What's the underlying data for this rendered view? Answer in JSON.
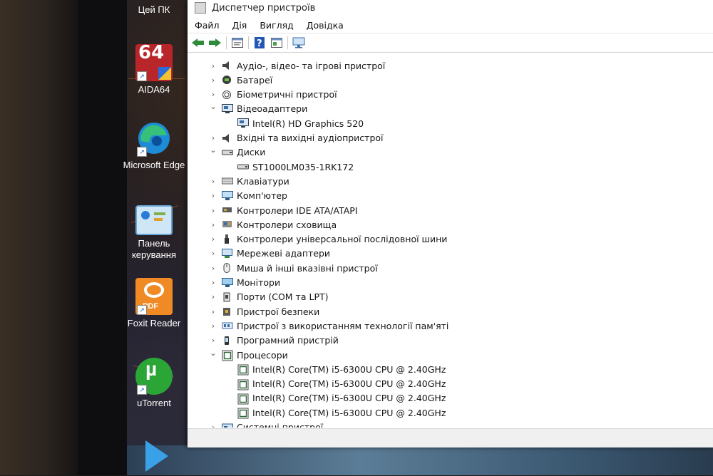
{
  "desktop": {
    "icons": [
      {
        "label": "Цей ПК"
      },
      {
        "label": "AIDA64",
        "badge": "64"
      },
      {
        "label": "Microsoft Edge"
      },
      {
        "label": "Панель керування"
      },
      {
        "label": "Foxit Reader",
        "badge": "PDF"
      },
      {
        "label": "uTorrent"
      }
    ]
  },
  "window": {
    "title": "Диспетчер пристроїв",
    "menu": [
      "Файл",
      "Дія",
      "Вигляд",
      "Довідка"
    ]
  },
  "tree": [
    {
      "label": "Аудіо-, відео- та ігрові пристрої",
      "level": 0,
      "state": "collapsed",
      "icon": "speaker-icon"
    },
    {
      "label": "Батареї",
      "level": 0,
      "state": "collapsed",
      "icon": "battery-icon"
    },
    {
      "label": "Біометричні пристрої",
      "level": 0,
      "state": "collapsed",
      "icon": "fingerprint-icon"
    },
    {
      "label": "Відеоадаптери",
      "level": 0,
      "state": "expanded",
      "icon": "display-adapter-icon"
    },
    {
      "label": "Intel(R) HD Graphics 520",
      "level": 1,
      "state": "leaf",
      "icon": "display-adapter-icon"
    },
    {
      "label": "Вхідні та вихідні аудіопристрої",
      "level": 0,
      "state": "collapsed",
      "icon": "speaker-icon"
    },
    {
      "label": "Диски",
      "level": 0,
      "state": "expanded",
      "icon": "disk-icon"
    },
    {
      "label": "ST1000LM035-1RK172",
      "level": 1,
      "state": "leaf",
      "icon": "disk-icon"
    },
    {
      "label": "Клавіатури",
      "level": 0,
      "state": "collapsed",
      "icon": "keyboard-icon"
    },
    {
      "label": "Комп'ютер",
      "level": 0,
      "state": "collapsed",
      "icon": "computer-icon"
    },
    {
      "label": "Контролери IDE ATA/ATAPI",
      "level": 0,
      "state": "collapsed",
      "icon": "controller-icon"
    },
    {
      "label": "Контролери сховища",
      "level": 0,
      "state": "collapsed",
      "icon": "storage-controller-icon"
    },
    {
      "label": "Контролери універсальної послідовної шини",
      "level": 0,
      "state": "collapsed",
      "icon": "usb-icon"
    },
    {
      "label": "Мережеві адаптери",
      "level": 0,
      "state": "collapsed",
      "icon": "network-icon"
    },
    {
      "label": "Миша й інші вказівні пристрої",
      "level": 0,
      "state": "collapsed",
      "icon": "mouse-icon"
    },
    {
      "label": "Монітори",
      "level": 0,
      "state": "collapsed",
      "icon": "monitor-icon"
    },
    {
      "label": "Порти (COM та LPT)",
      "level": 0,
      "state": "collapsed",
      "icon": "port-icon"
    },
    {
      "label": "Пристрої безпеки",
      "level": 0,
      "state": "collapsed",
      "icon": "security-icon"
    },
    {
      "label": "Пристрої з використанням технології пам'яті",
      "level": 0,
      "state": "collapsed",
      "icon": "memory-icon"
    },
    {
      "label": "Програмний пристрій",
      "level": 0,
      "state": "collapsed",
      "icon": "software-device-icon"
    },
    {
      "label": "Процесори",
      "level": 0,
      "state": "expanded",
      "icon": "processor-icon"
    },
    {
      "label": "Intel(R) Core(TM) i5-6300U CPU @ 2.40GHz",
      "level": 1,
      "state": "leaf",
      "icon": "processor-icon"
    },
    {
      "label": "Intel(R) Core(TM) i5-6300U CPU @ 2.40GHz",
      "level": 1,
      "state": "leaf",
      "icon": "processor-icon"
    },
    {
      "label": "Intel(R) Core(TM) i5-6300U CPU @ 2.40GHz",
      "level": 1,
      "state": "leaf",
      "icon": "processor-icon"
    },
    {
      "label": "Intel(R) Core(TM) i5-6300U CPU @ 2.40GHz",
      "level": 1,
      "state": "leaf",
      "icon": "processor-icon"
    },
    {
      "label": "Системні пристрої",
      "level": 0,
      "state": "collapsed",
      "icon": "system-device-icon"
    }
  ]
}
